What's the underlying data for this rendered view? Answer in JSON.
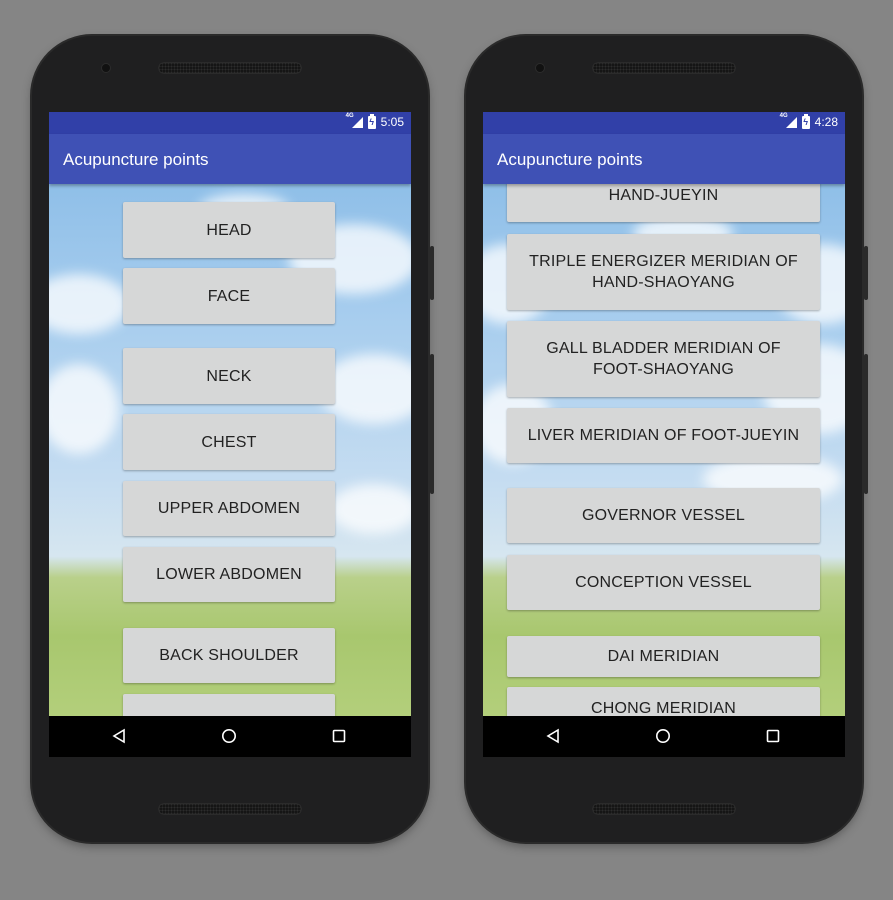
{
  "phones": [
    {
      "status": {
        "network": "4G",
        "time": "5:05"
      },
      "app_title": "Acupuncture points",
      "buttons": [
        "HEAD",
        "FACE",
        "NECK",
        "CHEST",
        "UPPER ABDOMEN",
        "LOWER ABDOMEN",
        "BACK SHOULDER",
        ""
      ]
    },
    {
      "status": {
        "network": "4G",
        "time": "4:28"
      },
      "app_title": "Acupuncture points",
      "buttons": [
        "HAND-JUEYIN",
        "TRIPLE ENERGIZER MERIDIAN OF HAND-SHAOYANG",
        "GALL BLADDER MERIDIAN OF FOOT-SHAOYANG",
        "LIVER MERIDIAN OF FOOT-JUEYIN",
        "GOVERNOR VESSEL",
        "CONCEPTION VESSEL",
        "DAI MERIDIAN",
        "CHONG MERIDIAN"
      ]
    }
  ],
  "nav": {
    "back_icon": "back-triangle-icon",
    "home_icon": "home-circle-icon",
    "recent_icon": "recent-square-icon"
  },
  "colors": {
    "status_bar": "#3140a8",
    "app_bar": "#3f51b5",
    "button": "#d6d7d7"
  }
}
